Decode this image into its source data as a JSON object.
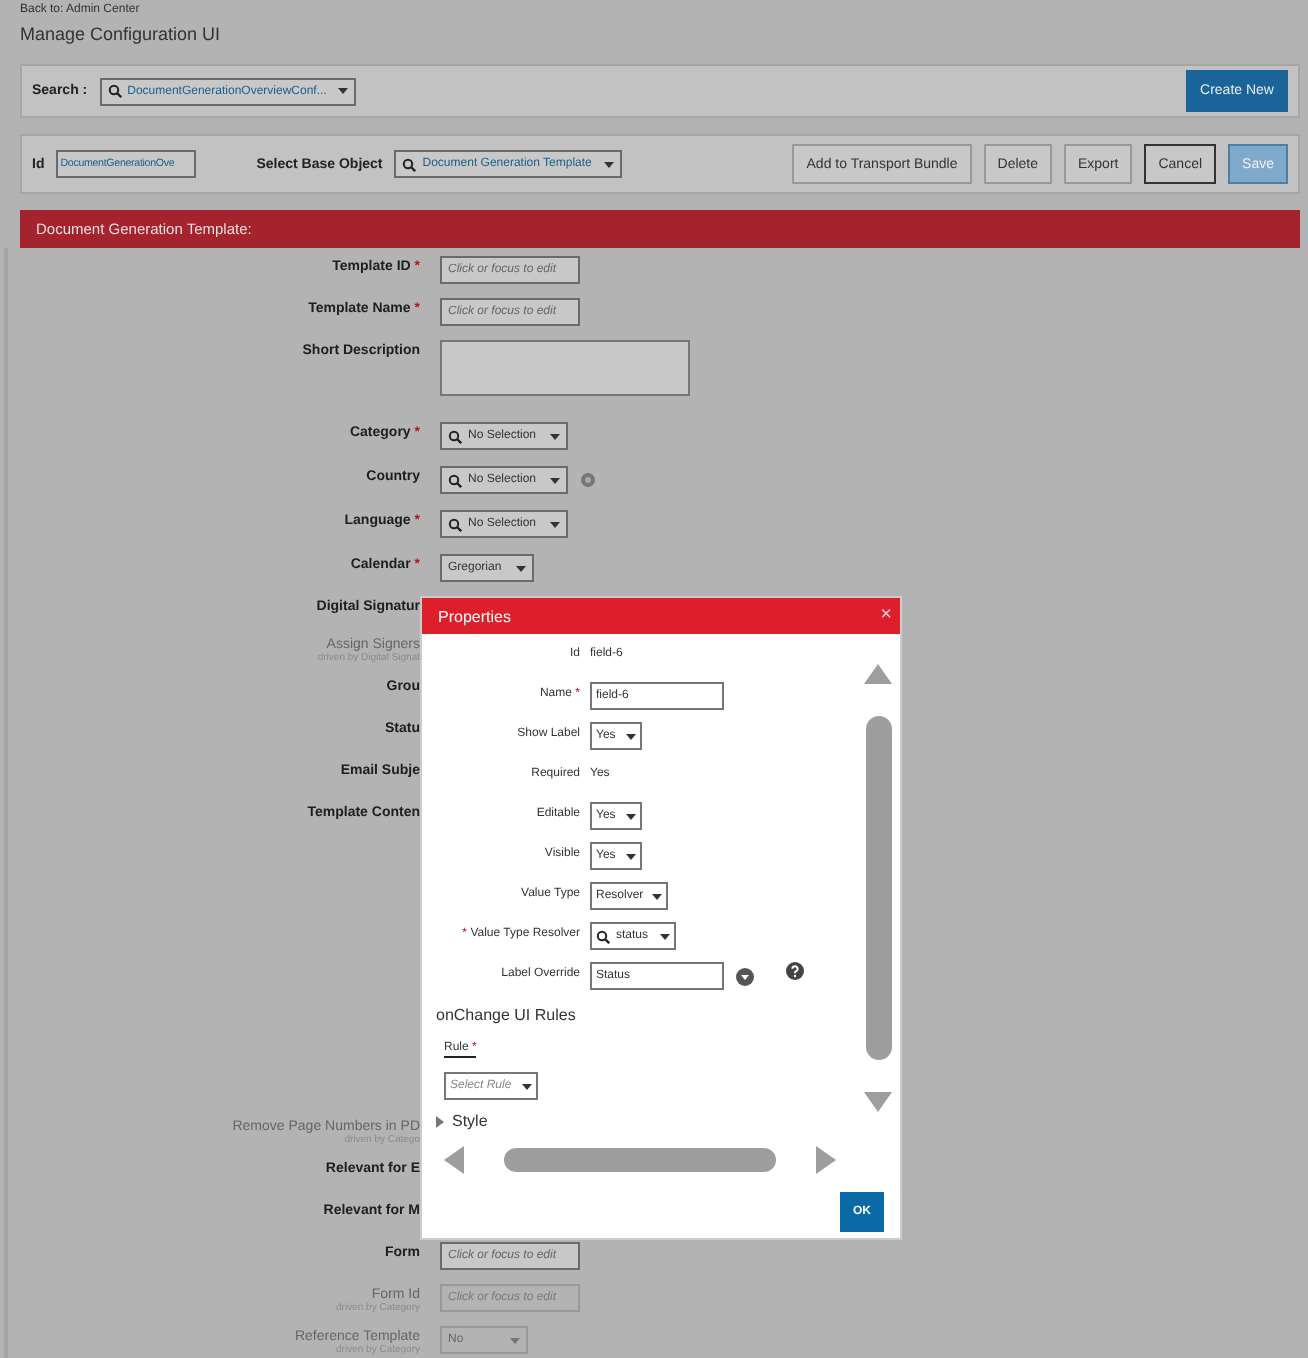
{
  "back_link": "Back to: Admin Center",
  "page_title": "Manage Configuration UI",
  "search": {
    "label": "Search :",
    "value": "DocumentGenerationOverviewConf..."
  },
  "create_button": "Create New",
  "id_field": {
    "label": "Id",
    "value": "DocumentGenerationOve"
  },
  "base_object": {
    "label": "Select Base Object",
    "value": "Document Generation Template"
  },
  "actions": [
    {
      "label": "Add to Transport Bundle",
      "kind": "default",
      "disabled": false
    },
    {
      "label": "Delete",
      "kind": "default",
      "disabled": false
    },
    {
      "label": "Export",
      "kind": "default",
      "disabled": false
    },
    {
      "label": "Cancel",
      "kind": "focused",
      "disabled": false
    },
    {
      "label": "Save",
      "kind": "primary",
      "disabled": true
    }
  ],
  "section_title": "Document Generation Template:",
  "fields": [
    {
      "label": "Template ID",
      "required_mark": "*",
      "disabled": false,
      "kind": "text",
      "placeholder": "Click or focus to edit"
    },
    {
      "label": "Template Name",
      "required_mark": "*",
      "disabled": false,
      "kind": "text",
      "placeholder": "Click or focus to edit"
    },
    {
      "label": "Short Description",
      "disabled": false,
      "kind": "textarea"
    },
    {
      "label": "Category",
      "required_mark": "*",
      "disabled": false,
      "kind": "lookup",
      "value": "No Selection"
    },
    {
      "label": "Country",
      "disabled": false,
      "kind": "lookup_icon",
      "value": "No Selection"
    },
    {
      "label": "Language",
      "required_mark": "*",
      "disabled": false,
      "kind": "lookup",
      "value": "No Selection"
    },
    {
      "label": "Calendar",
      "required_mark": "*",
      "disabled": false,
      "kind": "select",
      "value": "Gregorian"
    },
    {
      "label": "Digital Signatur",
      "disabled": false,
      "kind": "blank"
    },
    {
      "label": "Assign Signers",
      "driven_by": "driven by Digital Signat",
      "disabled": true,
      "kind": "none"
    },
    {
      "label": "Grou",
      "disabled": false,
      "kind": "none"
    },
    {
      "label": "Statu",
      "disabled": false,
      "kind": "none"
    },
    {
      "label": "Email Subje",
      "disabled": false,
      "kind": "none"
    },
    {
      "label": "Template Conten",
      "disabled": false,
      "kind": "content"
    },
    {
      "label": "Remove Page Numbers in PD",
      "driven_by": "driven by Catego",
      "disabled": true,
      "kind": "none"
    },
    {
      "label": "Relevant for E",
      "disabled": false,
      "kind": "none"
    },
    {
      "label": "Relevant for M",
      "disabled": false,
      "kind": "none"
    },
    {
      "label": "Form",
      "disabled": false,
      "kind": "text",
      "placeholder": "Click or focus to edit"
    },
    {
      "label": "Form Id",
      "driven_by": "driven by Category",
      "disabled": true,
      "kind": "text",
      "placeholder": "Click or focus to edit"
    },
    {
      "label": "Reference Template",
      "driven_by": "driven by Category",
      "disabled": true,
      "kind": "select",
      "value": "No"
    }
  ],
  "dialog": {
    "title": "Properties",
    "close": "×",
    "rows": [
      {
        "label": "Id",
        "kind": "static",
        "value": "field-6"
      },
      {
        "label": "Name",
        "mark_after": "*",
        "kind": "input",
        "value": "field-6"
      },
      {
        "label": "Show Label",
        "kind": "select",
        "value": "Yes"
      },
      {
        "label": "Required",
        "kind": "static",
        "value": "Yes"
      },
      {
        "label": "Editable",
        "kind": "select",
        "value": "Yes"
      },
      {
        "label": "Visible",
        "kind": "select",
        "value": "Yes"
      },
      {
        "label": "Value Type",
        "kind": "select",
        "value": "Resolver"
      },
      {
        "label": "Value Type Resolver",
        "mark_before": "*",
        "kind": "lookup",
        "value": "status"
      },
      {
        "label": "Label Override",
        "kind": "input_icons",
        "value": "Status"
      }
    ],
    "rules_heading": "onChange UI Rules",
    "rule": {
      "label": "Rule",
      "required_mark": "*",
      "placeholder": "Select Rule"
    },
    "style_section": {
      "label": "Style",
      "expanded": false
    },
    "ok_button": "OK"
  }
}
